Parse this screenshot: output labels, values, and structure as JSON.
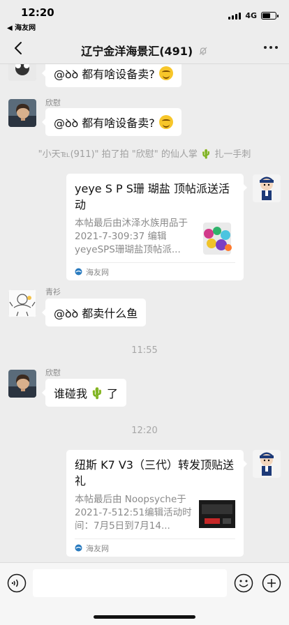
{
  "status_bar": {
    "time": "12:20",
    "back_app": "◀ 海友网",
    "network": "4G",
    "battery_level": 0.6
  },
  "nav": {
    "title": "辽宁金洋海景汇(491)",
    "muted_icon": "bell-slash-icon",
    "more_icon": "more-dots-icon"
  },
  "messages": {
    "m1": {
      "text": "@ꝺꝺ 都有啥设备卖?"
    },
    "m2": {
      "sender": "欣慰",
      "text": "@ꝺꝺ 都有啥设备卖?"
    },
    "system_pat": "\"小天℡(911)\" 拍了拍 \"欣慰\" 的仙人掌 🌵 扎一手刺",
    "card1": {
      "title": "yeye S P S珊 瑚盐 顶帖派送活动",
      "desc": "本帖最后由沐泽水族用品于 2021-7-309:37 编辑 yeyeSPS珊瑚盐顶帖派...",
      "source": "海友网"
    },
    "m3": {
      "sender": "青衫",
      "text": "@ꝺꝺ 都卖什么鱼"
    },
    "time1": "11:55",
    "m4": {
      "sender": "欣慰",
      "text_before": "谁碰我",
      "text_after": "了",
      "emoji": "🌵"
    },
    "time2": "12:20",
    "card2": {
      "title": "纽斯 K7 V3（三代）转发顶贴送礼",
      "desc": "本帖最后由 Noopsyche于 2021-7-512:51编辑活动时间：7月5日到7月14...",
      "source": "海友网"
    }
  },
  "input_bar": {
    "placeholder": "",
    "voice_icon": "voice-icon",
    "emoji_icon": "emoji-icon",
    "plus_icon": "plus-icon"
  },
  "colors": {
    "background": "#ededed",
    "bubble": "#ffffff",
    "system_text": "#a0a0a0"
  }
}
